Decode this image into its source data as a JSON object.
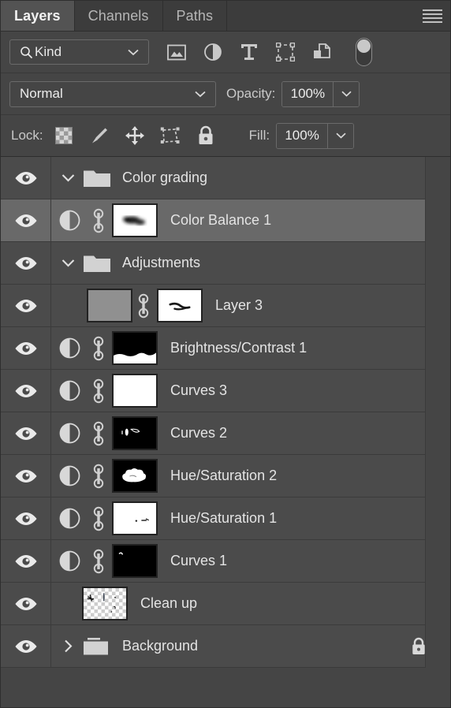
{
  "panel": {
    "tabs": [
      {
        "label": "Layers",
        "active": true
      },
      {
        "label": "Channels",
        "active": false
      },
      {
        "label": "Paths",
        "active": false
      }
    ],
    "menu_icon": "hamburger-menu-icon"
  },
  "filter": {
    "kind_label": "Kind",
    "search_icon": "magnifier-icon",
    "caret_icon": "chevron-down-icon",
    "icons": [
      "pixel-layer-filter-icon",
      "adjustment-layer-filter-icon",
      "type-layer-filter-icon",
      "shape-layer-filter-icon",
      "smart-object-filter-icon"
    ],
    "toggle": "filter-enable-toggle"
  },
  "blend": {
    "mode": "Normal",
    "opacity_label": "Opacity:",
    "opacity_value": "100%",
    "caret_icon": "chevron-down-icon"
  },
  "lock": {
    "label": "Lock:",
    "icons": [
      "lock-transparency-icon",
      "lock-image-pixels-icon",
      "lock-position-icon",
      "lock-artboard-nesting-icon",
      "lock-all-icon"
    ],
    "fill_label": "Fill:",
    "fill_value": "100%"
  },
  "colors": {
    "panel_bg": "#454545",
    "row_bg": "#4b4b4b",
    "row_selected_bg": "#696969",
    "tab_active_bg": "#535353",
    "text": "#e4e4e4",
    "muted_text": "#c9c9c9"
  },
  "layers": [
    {
      "name": "Color grading",
      "type": "group",
      "visible": true,
      "expanded": true,
      "indent": 0,
      "selected": false,
      "locked": false
    },
    {
      "name": "Color Balance 1",
      "type": "adjustment",
      "visible": true,
      "indent": 1,
      "selected": true,
      "linked": true,
      "mask": "soft-dark-blob-on-white",
      "locked": false
    },
    {
      "name": "Adjustments",
      "type": "group",
      "visible": true,
      "expanded": true,
      "indent": 0,
      "selected": false,
      "locked": false
    },
    {
      "name": "Layer 3",
      "type": "pixel",
      "visible": true,
      "indent": 1,
      "selected": false,
      "linked": true,
      "pixel": "flat-gray",
      "mask": "white-with-dark-strokes",
      "locked": false
    },
    {
      "name": "Brightness/Contrast 1",
      "type": "adjustment",
      "visible": true,
      "indent": 1,
      "selected": false,
      "linked": true,
      "mask": "black-top-white-bottom",
      "locked": false
    },
    {
      "name": "Curves 3",
      "type": "adjustment",
      "visible": true,
      "indent": 1,
      "selected": false,
      "linked": true,
      "mask": "all-white",
      "locked": false
    },
    {
      "name": "Curves 2",
      "type": "adjustment",
      "visible": true,
      "indent": 1,
      "selected": false,
      "linked": true,
      "mask": "black-with-small-white-marks",
      "locked": false
    },
    {
      "name": "Hue/Saturation 2",
      "type": "adjustment",
      "visible": true,
      "indent": 1,
      "selected": false,
      "linked": true,
      "mask": "black-with-white-cloud",
      "locked": false
    },
    {
      "name": "Hue/Saturation 1",
      "type": "adjustment",
      "visible": true,
      "indent": 1,
      "selected": false,
      "linked": true,
      "mask": "white-with-small-dark-marks",
      "locked": false
    },
    {
      "name": "Curves 1",
      "type": "adjustment",
      "visible": true,
      "indent": 1,
      "selected": false,
      "linked": true,
      "mask": "black-with-tiny-white-mark",
      "locked": false
    },
    {
      "name": "Clean up",
      "type": "pixel",
      "visible": true,
      "indent": 1,
      "selected": false,
      "linked": false,
      "pixel": "transparent-checkerboard-with-marks",
      "locked": false
    },
    {
      "name": "Background",
      "type": "group",
      "visible": true,
      "expanded": false,
      "indent": 0,
      "selected": false,
      "locked": true
    }
  ]
}
